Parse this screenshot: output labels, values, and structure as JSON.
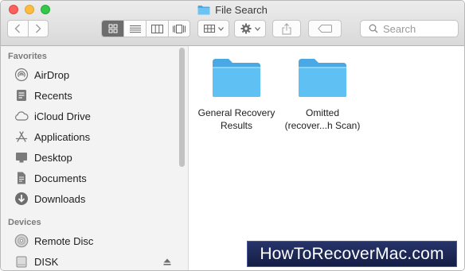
{
  "window": {
    "title": "File Search"
  },
  "toolbar": {
    "back_icon": "chevron-left-icon",
    "forward_icon": "chevron-right-icon",
    "view_modes": [
      "icon-view",
      "list-view",
      "column-view",
      "cover-flow-view"
    ],
    "active_view": "icon-view",
    "search_placeholder": "Search"
  },
  "sidebar": {
    "favorites_header": "Favorites",
    "favorites": [
      {
        "label": "AirDrop",
        "icon": "airdrop-icon"
      },
      {
        "label": "Recents",
        "icon": "recents-icon"
      },
      {
        "label": "iCloud Drive",
        "icon": "cloud-icon"
      },
      {
        "label": "Applications",
        "icon": "applications-icon"
      },
      {
        "label": "Desktop",
        "icon": "desktop-icon"
      },
      {
        "label": "Documents",
        "icon": "documents-icon"
      },
      {
        "label": "Downloads",
        "icon": "downloads-icon"
      }
    ],
    "devices_header": "Devices",
    "devices": [
      {
        "label": "Remote Disc",
        "icon": "disc-icon"
      },
      {
        "label": "DISK",
        "icon": "drive-icon"
      }
    ]
  },
  "main": {
    "items": [
      {
        "line1": "General Recovery",
        "line2": "Results"
      },
      {
        "line1": "Omitted",
        "line2": "(recover...h Scan)"
      }
    ]
  },
  "watermark": "HowToRecoverMac.com",
  "colors": {
    "folder": "#5fc0f4",
    "folder_tab": "#4aa9e4",
    "active_segment": "#6d6d6d"
  }
}
